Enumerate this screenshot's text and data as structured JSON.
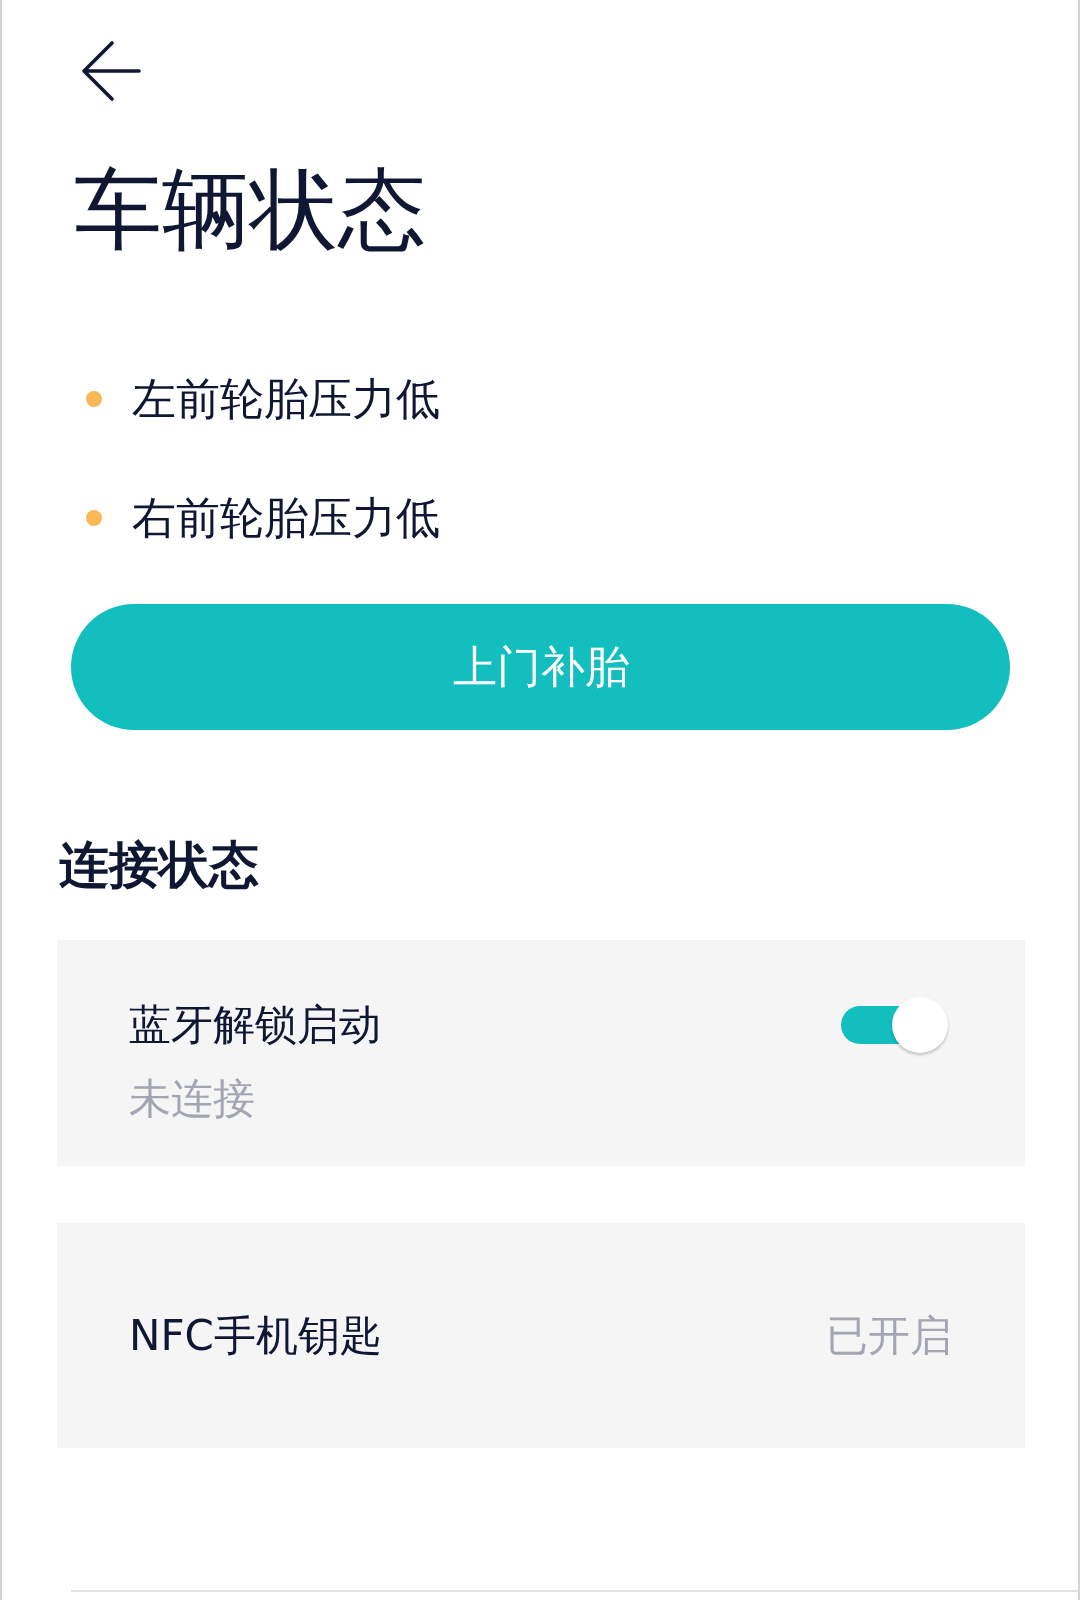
{
  "header": {
    "title": "车辆状态"
  },
  "alerts": [
    {
      "text": "左前轮胎压力低"
    },
    {
      "text": "右前轮胎压力低"
    }
  ],
  "action_button": {
    "label": "上门补胎"
  },
  "connection": {
    "title": "连接状态",
    "items": [
      {
        "kind": "toggle",
        "label": "蓝牙解锁启动",
        "status": "未连接",
        "on": true
      },
      {
        "kind": "value",
        "label": "NFC手机钥匙",
        "value": "已开启"
      }
    ]
  }
}
